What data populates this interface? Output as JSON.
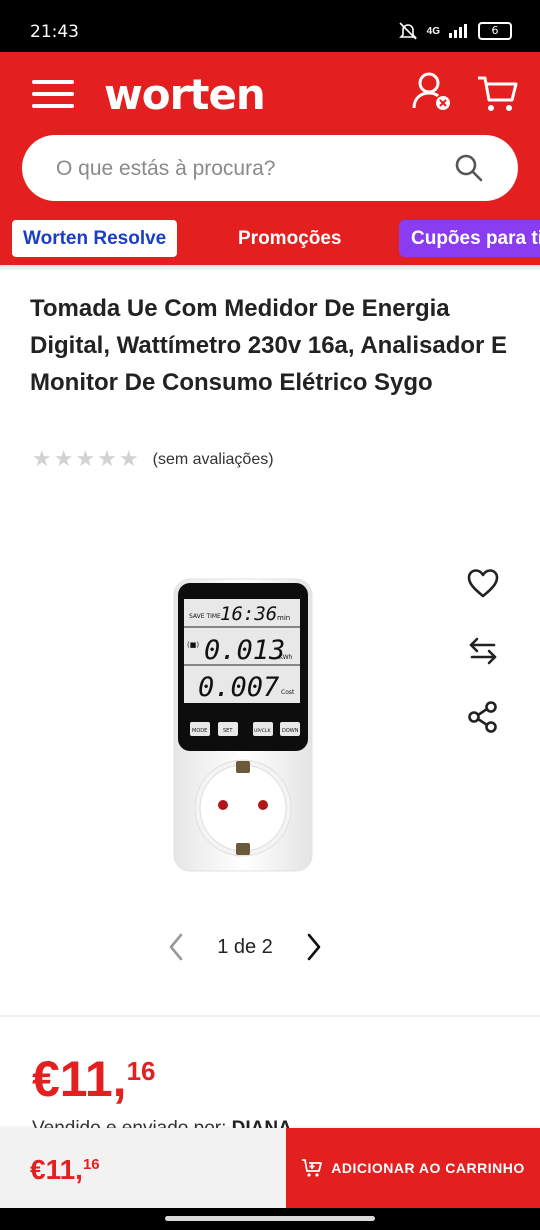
{
  "status_bar": {
    "time": "21:43",
    "network": "4G",
    "battery": "6"
  },
  "header": {
    "logo": "worten",
    "search_placeholder": "O que estás à procura?"
  },
  "chips": [
    {
      "label": "Worten Resolve"
    },
    {
      "label": "Promoções"
    },
    {
      "label": "Cupões para ti"
    }
  ],
  "product": {
    "title": "Tomada Ue Com Medidor De Energia Digital, Wattímetro 230v 16a, Analisador E Monitor De Consumo Elétrico Sygo",
    "rating_stars": 0,
    "rating_text": "(sem avaliações)",
    "display": {
      "top_label": "SAVE TIME",
      "time": "16:36",
      "time_unit": "min",
      "energy": "0.013",
      "energy_unit": "KWh",
      "cost": "0.007",
      "cost_unit": "Cost",
      "buttons": [
        "MODE",
        "SET",
        "UP/CLK",
        "DOWN"
      ]
    },
    "image_pager": {
      "text": "1 de 2"
    }
  },
  "price": {
    "euro": "€11,",
    "cents": "16"
  },
  "seller": {
    "prefix": "Vendido e enviado por:",
    "name": "DIANA"
  },
  "bottom_bar": {
    "price_euro": "€11,",
    "price_cents": "16",
    "add_to_cart": "ADICIONAR AO CARRINHO"
  },
  "colors": {
    "brand_red": "#e41f1f",
    "chip_blue": "#1a3ec6",
    "chip_purple": "#8a3cf0"
  }
}
